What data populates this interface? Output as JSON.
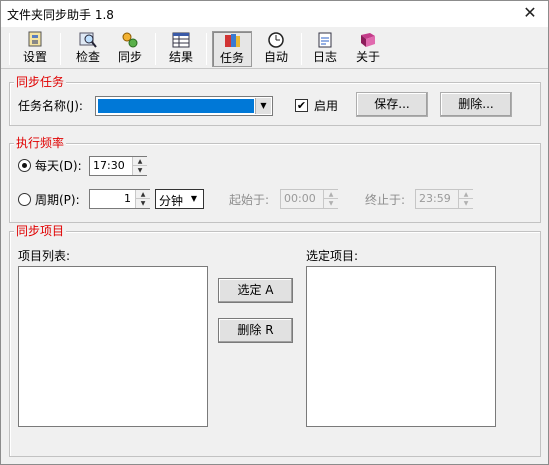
{
  "window": {
    "title": "文件夹同步助手 1.8",
    "close": "✕"
  },
  "toolbar": {
    "items": [
      {
        "label": "设置",
        "icon": "settings-icon"
      },
      {
        "label": "检查",
        "icon": "inspect-icon"
      },
      {
        "label": "同步",
        "icon": "sync-icon"
      },
      {
        "label": "结果",
        "icon": "results-icon"
      },
      {
        "label": "任务",
        "icon": "task-icon",
        "active": true
      },
      {
        "label": "自动",
        "icon": "clock-icon"
      },
      {
        "label": "日志",
        "icon": "log-icon"
      },
      {
        "label": "关于",
        "icon": "about-icon"
      }
    ]
  },
  "sync_task": {
    "legend": "同步任务",
    "task_name_label": "任务名称(J):",
    "enable_label": "启用",
    "enable_checked": true,
    "save_button": "保存...",
    "delete_button": "删除..."
  },
  "frequency": {
    "legend": "执行频率",
    "daily_label": "每天(D):",
    "daily_time": "17:30",
    "period_label": "周期(P):",
    "period_value": "1",
    "period_unit": "分钟",
    "start_label": "起始于:",
    "start_time": "00:00",
    "end_label": "终止于:",
    "end_time": "23:59"
  },
  "items": {
    "legend": "同步项目",
    "list_label": "项目列表:",
    "selected_label": "选定项目:",
    "select_button": "选定 A",
    "remove_button": "删除 R"
  }
}
